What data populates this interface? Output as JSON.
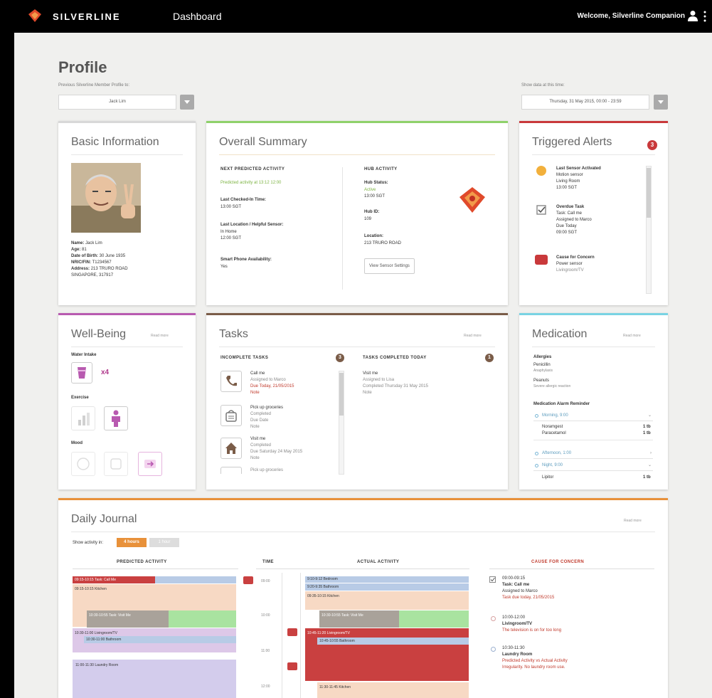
{
  "header": {
    "brand": "SILVERLINE",
    "nav_dashboard": "Dashboard",
    "welcome": "Welcome, Silverline Companion"
  },
  "profile": {
    "title": "Profile",
    "select_label": "Previous Silverline Member Profile to:",
    "selected_member": "Jack Lim",
    "date_label": "Show data at this time:",
    "selected_time": "Thursday, 31 May 2015, 00:00 - 23:59"
  },
  "basic_info": {
    "title": "Basic Information",
    "name_label": "Name:",
    "name": "Jack Lim",
    "age_label": "Age:",
    "age": "81",
    "dob_label": "Date of Birth:",
    "dob": "30 June 1935",
    "nric_label": "NRIC/FIN:",
    "nric": "T1234567",
    "address_label": "Address:",
    "address": "213 TRURO ROAD",
    "city": "SINGAPORE, 317917"
  },
  "overall_summary": {
    "title": "Overall Summary",
    "next_activity_header": "NEXT PREDICTED ACTIVITY",
    "next_activity": "Predicted activity at 13:12 12:00",
    "last_checked_in_label": "Last Checked-In Time:",
    "last_checked_in": "13:00 SGT",
    "last_location_label": "Last Location / Helpful Sensor:",
    "last_location": "In Home",
    "last_location_time": "12:00 SGT",
    "smartphone_label": "Smart Phone Availability:",
    "smartphone": "Yes",
    "hub_header": "HUB ACTIVITY",
    "hub_status_label": "Hub Status:",
    "hub_status": "Active",
    "hub_status_time": "13:00 SGT",
    "hub_id_label": "Hub ID:",
    "hub_id": "109",
    "location_label": "Location:",
    "location": "213 TRURO ROAD",
    "view_sensor_button": "View Sensor Settings"
  },
  "triggered_alerts": {
    "title": "Triggered Alerts",
    "count": "3",
    "items": [
      {
        "title": "Last Sensor Activated",
        "lines": [
          "Motion sensor",
          "Living Room",
          "13:00 SGT"
        ]
      },
      {
        "title": "Overdue Task",
        "lines": [
          "Task: Call me",
          "Assigned to Marco",
          "Due Today",
          "09:00 SGT"
        ]
      },
      {
        "title": "Cause for Concern",
        "lines": [
          "Power sensor",
          "Livingroom/TV"
        ]
      }
    ]
  },
  "wellbeing": {
    "title": "Well-Being",
    "more": "Read more",
    "water_label": "Water Intake",
    "water_count": "x4",
    "exercise_label": "Exercise",
    "mood_label": "Mood"
  },
  "tasks": {
    "title": "Tasks",
    "more": "Read more",
    "incomplete_header": "INCOMPLETE TASKS",
    "incomplete_count": "3",
    "completed_header": "TASKS COMPLETED TODAY",
    "completed_count": "1",
    "incomplete": [
      {
        "title": "Call me",
        "lines": [
          "Assigned to Marco",
          "Due Today, 21/05/2015"
        ],
        "status": "Note"
      },
      {
        "title": "Pick up groceries",
        "lines": [
          "Completed",
          "Due Date",
          "Note"
        ]
      },
      {
        "title": "Visit me",
        "lines": [
          "Completed",
          "Due Saturday 24 May 2015",
          "Note"
        ]
      },
      {
        "title": "Pick up groceries"
      }
    ],
    "completed": [
      {
        "title": "Visit me",
        "lines": [
          "Assigned to Lisa",
          "Completed Thursday 31 May 2015",
          "Note"
        ]
      }
    ]
  },
  "medication": {
    "title": "Medication",
    "more": "Read more",
    "allergies_label": "Allergies",
    "allergy1": "Penicillin",
    "allergy1_note": "Anaphylaxis",
    "allergy2": "Peanuts",
    "allergy2_note": "Severe allergic reaction",
    "reminders_label": "Medication Alarm Reminder",
    "groups": [
      {
        "time": "Morning, 9:00",
        "meds": [
          {
            "name": "Noramgest",
            "qty": "1 tb"
          },
          {
            "name": "Paracetamol",
            "qty": "1 tb"
          }
        ]
      },
      {
        "time": "Afternoon, 1:00",
        "meds": []
      },
      {
        "time": "Night, 9:00",
        "meds": [
          {
            "name": "Lipitor",
            "qty": "1 tb"
          }
        ]
      }
    ]
  },
  "journal": {
    "title": "Daily Journal",
    "more": "Read more",
    "show_label": "Show activity in:",
    "toggle_active": "4 hours",
    "toggle_inactive": "1 hour",
    "col_predicted": "PREDICTED ACTIVITY",
    "col_time": "TIME",
    "col_actual": "ACTUAL ACTIVITY",
    "col_concern": "CAUSE FOR CONCERN",
    "times": [
      "09:00",
      "10:00",
      "11:00",
      "12:00"
    ],
    "predicted_blocks": [
      "09:15-10:15 Task: Call Me",
      "09:15-10:15 Kitchen",
      "10:30-10:55 Task: Visit Me",
      "10:30-11:00 Livingroom/TV",
      "10:30-11:00 Bathroom",
      "11:00-11:30 Laundry Room"
    ],
    "actual_blocks": [
      "9:10-9:12 Bedroom",
      "9:20-9:35 Bathroom",
      "09:35-10:15 Kitchen",
      "10:30-10:55 Task: Visit Me",
      "10:45-11:20 Livingroom/TV",
      "10:45-10:55 Bathroom",
      "11:30-11:45 Kitchen"
    ],
    "concerns": [
      {
        "time": "09:00-09:15",
        "title": "Task: Call me",
        "line1": "Assigned to Marco",
        "line2": "Task due today, 21/05/2015"
      },
      {
        "time": "10:00-12:00",
        "title": "Livingroom/TV",
        "line1": "The television is on for too long"
      },
      {
        "time": "10:30-11:30",
        "title": "Laundry Room",
        "line1": "Predicted Activity vs Actual Activity",
        "line2": "Irregularity. No laundry room use."
      }
    ]
  },
  "colors": {
    "accent_orange": "#e8913a",
    "alert_red": "#c9393b",
    "well_purple": "#b85ab0",
    "summary_green": "#8fd16a",
    "tasks_brown": "#7a5c48",
    "med_cyan": "#79d3e3",
    "pred_peach": "#f7d9c4",
    "pred_lavender": "#ddc8e8",
    "pred_blue": "#b8cbe6",
    "act_red": "#c94040",
    "act_green": "#a9e3a0",
    "act_gray": "#c3c3c3"
  }
}
